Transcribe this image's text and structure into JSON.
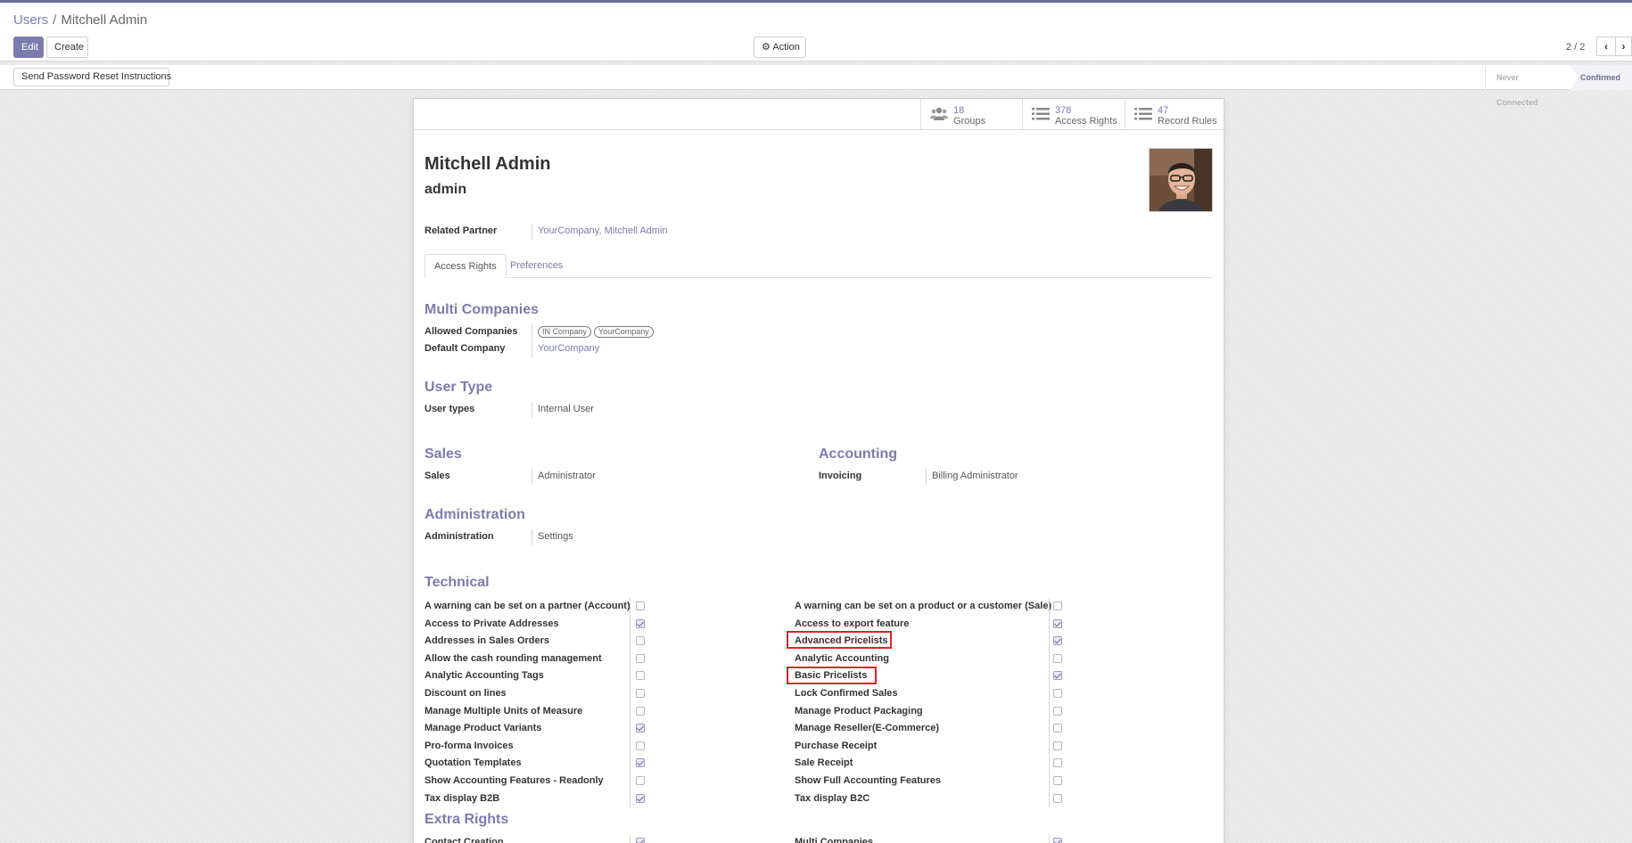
{
  "breadcrumb": {
    "parent": "Users",
    "current": "Mitchell Admin"
  },
  "toolbar": {
    "edit_label": "Edit",
    "create_label": "Create",
    "action_label": "Action"
  },
  "pager": {
    "value": "2 / 2"
  },
  "statusbar": {
    "reset_button_label": "Send Password Reset Instructions",
    "stages": [
      "Never Connected",
      "Confirmed"
    ],
    "active_stage": "Confirmed"
  },
  "stat_buttons": [
    {
      "value": "18",
      "label": "Groups",
      "icon": "users-icon"
    },
    {
      "value": "378",
      "label": "Access Rights",
      "icon": "list-icon"
    },
    {
      "value": "47",
      "label": "Record Rules",
      "icon": "list-icon"
    }
  ],
  "user": {
    "name": "Mitchell Admin",
    "login": "admin"
  },
  "related_partner": {
    "label": "Related Partner",
    "value": "YourCompany, Mitchell Admin"
  },
  "tabs": [
    {
      "label": "Access Rights",
      "active": true
    },
    {
      "label": "Preferences",
      "active": false
    }
  ],
  "multi_companies": {
    "title": "Multi Companies",
    "allowed_label": "Allowed Companies",
    "allowed_tags": [
      "IN Company",
      "YourCompany"
    ],
    "default_label": "Default Company",
    "default_value": "YourCompany"
  },
  "user_type": {
    "title": "User Type",
    "label": "User types",
    "value": "Internal User"
  },
  "sales": {
    "title": "Sales",
    "label": "Sales",
    "value": "Administrator"
  },
  "accounting": {
    "title": "Accounting",
    "label": "Invoicing",
    "value": "Billing Administrator"
  },
  "administration": {
    "title": "Administration",
    "label": "Administration",
    "value": "Settings"
  },
  "technical": {
    "title": "Technical",
    "left": [
      {
        "label": "A warning can be set on a partner (Account)",
        "checked": false
      },
      {
        "label": "Access to Private Addresses",
        "checked": true
      },
      {
        "label": "Addresses in Sales Orders",
        "checked": false
      },
      {
        "label": "Allow the cash rounding management",
        "checked": false
      },
      {
        "label": "Analytic Accounting Tags",
        "checked": false
      },
      {
        "label": "Discount on lines",
        "checked": false
      },
      {
        "label": "Manage Multiple Units of Measure",
        "checked": false
      },
      {
        "label": "Manage Product Variants",
        "checked": true
      },
      {
        "label": "Pro-forma Invoices",
        "checked": false
      },
      {
        "label": "Quotation Templates",
        "checked": true
      },
      {
        "label": "Show Accounting Features - Readonly",
        "checked": false
      },
      {
        "label": "Tax display B2B",
        "checked": true
      }
    ],
    "right": [
      {
        "label": "A warning can be set on a product or a customer (Sale)",
        "checked": false
      },
      {
        "label": "Access to export feature",
        "checked": true
      },
      {
        "label": "Advanced Pricelists",
        "checked": true
      },
      {
        "label": "Analytic Accounting",
        "checked": false
      },
      {
        "label": "Basic Pricelists",
        "checked": true
      },
      {
        "label": "Lock Confirmed Sales",
        "checked": false
      },
      {
        "label": "Manage Product Packaging",
        "checked": false
      },
      {
        "label": "Manage Reseller(E-Commerce)",
        "checked": false
      },
      {
        "label": "Purchase Receipt",
        "checked": false
      },
      {
        "label": "Sale Receipt",
        "checked": false
      },
      {
        "label": "Show Full Accounting Features",
        "checked": false
      },
      {
        "label": "Tax display B2C",
        "checked": false
      }
    ]
  },
  "extra_rights": {
    "title": "Extra Rights",
    "left": [
      {
        "label": "Contact Creation",
        "checked": true
      }
    ],
    "right": [
      {
        "label": "Multi Companies",
        "checked": true
      }
    ]
  },
  "colors": {
    "accent": "#7c7bad",
    "highlight": "#e02020"
  }
}
